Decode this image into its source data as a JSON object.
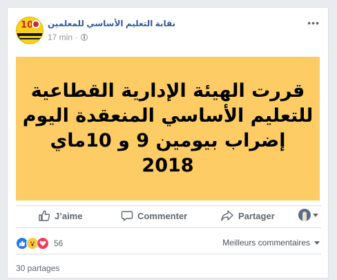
{
  "post": {
    "page_name": "نقابة التعليم الأساسي للمعلمين",
    "time": "17 min",
    "privacy_icon": "globe-icon",
    "more_label": "•••",
    "image_lines": [
      "قررت الهيئة الإدارية القطاعية",
      "للتعليم الأساسي المنعقدة اليوم",
      "إضراب بيومين 9 و 10ماي",
      "2018"
    ],
    "image_bg": "#fdcc65"
  },
  "actions": {
    "like": "J’aime",
    "comment": "Commenter",
    "share": "Partager"
  },
  "footer": {
    "reaction_count": "56",
    "sort_label": "Meilleurs commentaires",
    "shares_label": "30 partages"
  },
  "colors": {
    "link": "#365899",
    "muted": "#606770",
    "like": "#2078f4",
    "love": "#f33e58",
    "wow": "#fcc83c"
  }
}
